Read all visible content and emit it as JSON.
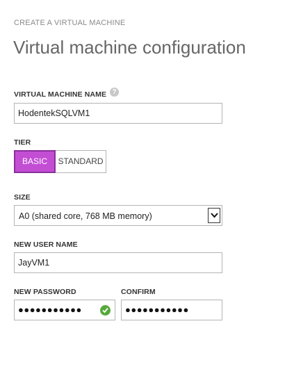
{
  "header": {
    "eyebrow": "CREATE A VIRTUAL MACHINE",
    "title": "Virtual machine configuration"
  },
  "vm_name": {
    "label": "VIRTUAL MACHINE NAME",
    "help_icon": "question-mark-icon",
    "help_glyph": "?",
    "value": "HodentekSQLVM1"
  },
  "tier": {
    "label": "TIER",
    "options": [
      "BASIC",
      "STANDARD"
    ],
    "selected": "BASIC",
    "accent_color": "#c34ed4"
  },
  "size": {
    "label": "SIZE",
    "selected": "A0 (shared core, 768 MB memory)",
    "arrow_icon": "chevron-down-icon"
  },
  "user": {
    "label": "NEW USER NAME",
    "value": "JayVM1"
  },
  "password": {
    "label": "NEW PASSWORD",
    "masked_value": "●●●●●●●●●●●",
    "valid_icon": "check-circle-icon",
    "valid_color": "#57a83b"
  },
  "confirm": {
    "label": "CONFIRM",
    "masked_value": "●●●●●●●●●●●"
  }
}
